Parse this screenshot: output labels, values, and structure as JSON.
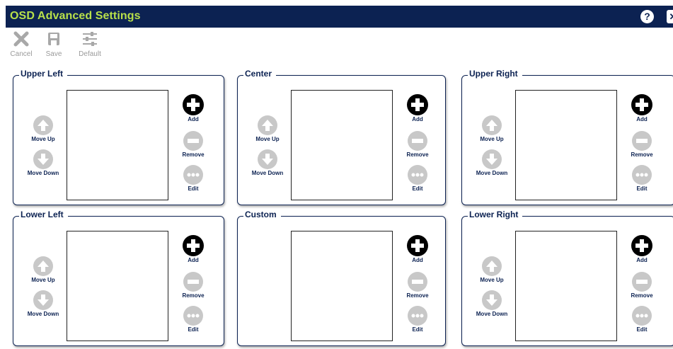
{
  "window": {
    "title": "OSD Advanced Settings",
    "help_glyph": "?",
    "close_glyph": "✕",
    "colors": {
      "titlebar": "#0c2252",
      "title_text": "#b8e04a",
      "accent_text": "#0c2252"
    }
  },
  "toolbar": {
    "cancel_label": "Cancel",
    "save_label": "Save",
    "default_label": "Default"
  },
  "panels": [
    {
      "title": "Upper Left",
      "has_move": true
    },
    {
      "title": "Center",
      "has_move": true
    },
    {
      "title": "Upper Right",
      "has_move": true
    },
    {
      "title": "Lower Left",
      "has_move": true
    },
    {
      "title": "Custom",
      "has_move": false
    },
    {
      "title": "Lower Right",
      "has_move": true
    }
  ],
  "labels": {
    "move_up": "Move Up",
    "move_down": "Move Down",
    "add": "Add",
    "remove": "Remove",
    "edit": "Edit"
  }
}
